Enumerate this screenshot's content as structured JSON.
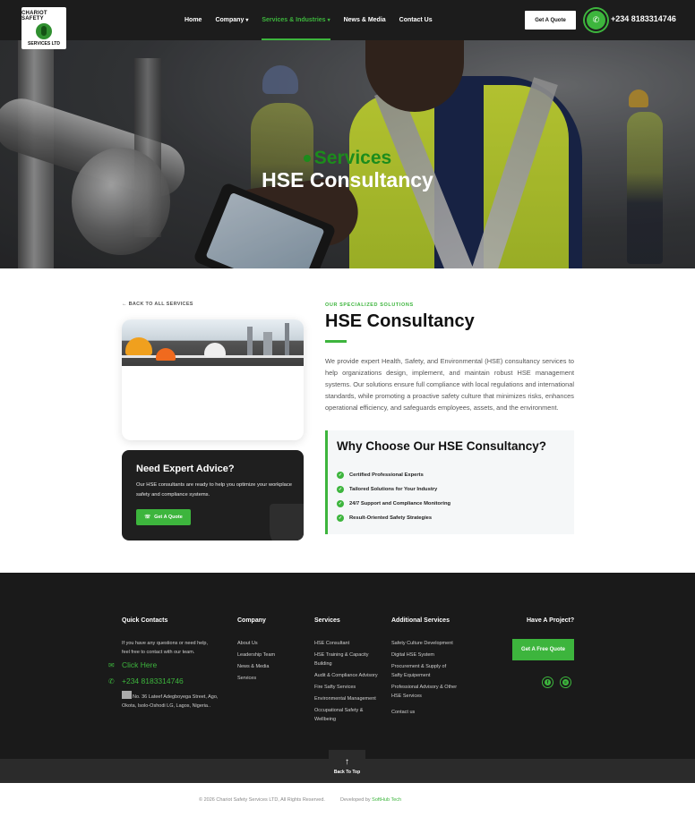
{
  "header": {
    "logo_top": "CHARIOT SAFETY",
    "logo_bottom": "SERVICES LTD",
    "nav": [
      {
        "label": "Home",
        "caret": ""
      },
      {
        "label": "Company",
        "caret": "▾"
      },
      {
        "label": "Services & Industries",
        "caret": "▾"
      },
      {
        "label": "News & Media",
        "caret": ""
      },
      {
        "label": "Contact Us",
        "caret": ""
      }
    ],
    "quote_label": "Get A Quote",
    "phone": "+234 8183314746"
  },
  "hero": {
    "eyebrow": "Services",
    "title": "HSE Consultancy"
  },
  "main": {
    "back_link": "BACK TO ALL SERVICES",
    "eyebrow": "OUR SPECIALIZED SOLUTIONS",
    "title": "HSE Consultancy",
    "description": "We provide expert Health, Safety, and Environmental (HSE) consultancy services to help organizations design, implement, and maintain robust HSE management systems. Our solutions ensure full compliance with local regulations and international standards, while promoting a proactive safety culture that minimizes risks, enhances operational efficiency, and safeguards employees, assets, and the environment.",
    "why": {
      "title": "Why Choose Our HSE Consultancy?",
      "items": [
        "Certified Professional Experts",
        "Tailored Solutions for Your Industry",
        "24/7 Support and Compliance Monitoring",
        "Result-Oriented Safety Strategies"
      ]
    },
    "advice": {
      "title": "Need Expert Advice?",
      "text": "Our HSE consultants are ready to help you optimize your workplace safety and compliance systems.",
      "button": "Get A Quote"
    }
  },
  "footer": {
    "quick_contacts": {
      "heading": "Quick Contacts",
      "intro": "If you have any questions or need help, feel free to contact with our team.",
      "click_here": "Click Here",
      "phone": "+234 8183314746",
      "address": "No. 36 Lateef Adegboyega Street, Ago, Okota, Isolo-Oshodi LG, Lagos, Nigeria.."
    },
    "company": {
      "heading": "Company",
      "items": [
        "About Us",
        "Leadership Team",
        "News & Media",
        "Services"
      ]
    },
    "services": {
      "heading": "Services",
      "items": [
        "HSE Consultant",
        "HSE Training & Capacity Building",
        "Audit & Compliance Advisory",
        "Fire Safty Services",
        "Environmental Management",
        "Occupational Safety & Wellbeing"
      ]
    },
    "additional": {
      "heading": "Additional Services",
      "items": [
        "Safety Culture Development",
        "Digital HSE System",
        "Procurement & Supply of Safty Equipement",
        "Professional Advisory & Other HSE Services",
        "Contact us"
      ]
    },
    "project": {
      "heading": "Have A Project?",
      "button": "Get A Free Quote",
      "social": [
        {
          "icon": "facebook-icon",
          "glyph": "f"
        },
        {
          "icon": "spotify-icon",
          "glyph": "≡"
        }
      ]
    },
    "back_to_top": "Back To Top",
    "copyright": "© 2026 Chariot Safety Services LTD, All Rights Reserved.",
    "developed_by": "Developed by",
    "developer": "SoftHub Tech"
  },
  "colors": {
    "accent": "#3db53d",
    "dark": "#1c1c1c"
  }
}
